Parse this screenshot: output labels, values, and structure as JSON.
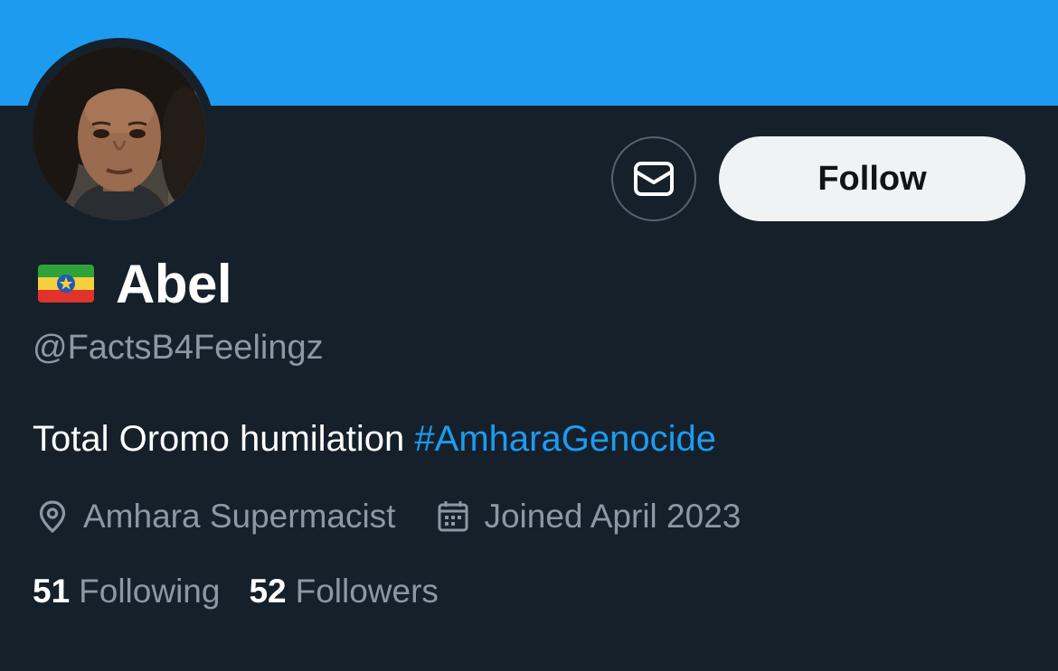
{
  "colors": {
    "banner": "#1d9bf0",
    "background": "#15202b",
    "primary_text": "#ffffff",
    "secondary_text": "#8b98a5",
    "link": "#1d9bf0",
    "follow_button_bg": "#eff3f4",
    "follow_button_text": "#0f1419"
  },
  "profile": {
    "flag_icon": "ethiopia-flag-icon",
    "display_name": "Abel",
    "handle": "@FactsB4Feelingz",
    "bio_text": "Total Oromo humilation ",
    "bio_hashtag": "#AmharaGenocide",
    "location_icon": "location-pin-icon",
    "location": "Amhara Supermacist",
    "joined_icon": "calendar-icon",
    "joined": "Joined April 2023"
  },
  "actions": {
    "message_icon": "envelope-icon",
    "follow_label": "Follow"
  },
  "stats": {
    "following_count": "51",
    "following_label": "Following",
    "followers_count": "52",
    "followers_label": "Followers"
  }
}
